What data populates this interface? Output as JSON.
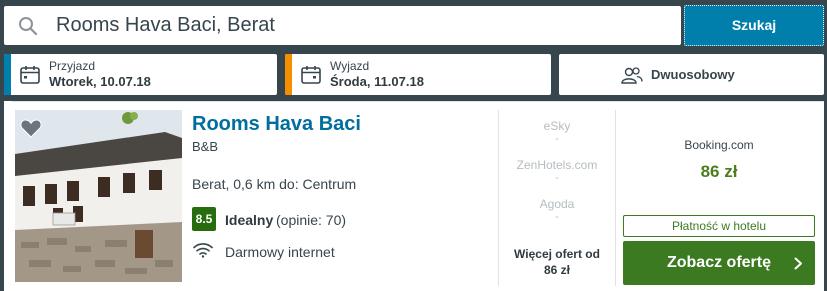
{
  "search": {
    "value": "Rooms Hava Baci, Berat",
    "button_label": "Szukaj"
  },
  "checkin": {
    "label": "Przyjazd",
    "value": "Wtorek, 10.07.18",
    "accent": "#007fad"
  },
  "checkout": {
    "label": "Wyjazd",
    "value": "Środa, 11.07.18",
    "accent": "#f48f00"
  },
  "room": {
    "value": "Dwuosobowy"
  },
  "hotel": {
    "name": "Rooms Hava Baci",
    "type": "B&B",
    "location": "Berat, 0,6 km do: Centrum",
    "rating_score": "8.5",
    "rating_word": "Idealny",
    "rating_count": "(opinie: 70)",
    "amenity": "Darmowy internet"
  },
  "alt_providers": [
    {
      "name": "eSky",
      "price": "-"
    },
    {
      "name": "ZenHotels.com",
      "price": "-"
    },
    {
      "name": "Agoda",
      "price": "-"
    }
  ],
  "more_offers": {
    "line1": "Więcej ofert od",
    "line2": "86 zł"
  },
  "best_offer": {
    "provider": "Booking.com",
    "price": "86 zł",
    "payment_badge": "Płatność w hotelu",
    "cta_label": "Zobacz ofertę"
  },
  "icons": {
    "search": "search-icon",
    "calendar": "calendar-icon",
    "people": "people-icon",
    "heart": "heart-icon",
    "wifi": "wifi-icon",
    "chevron": "chevron-right-icon"
  },
  "colors": {
    "brand_blue": "#007fad",
    "orange": "#f48f00",
    "green": "#3c7a22",
    "rating_green": "#276d10"
  }
}
